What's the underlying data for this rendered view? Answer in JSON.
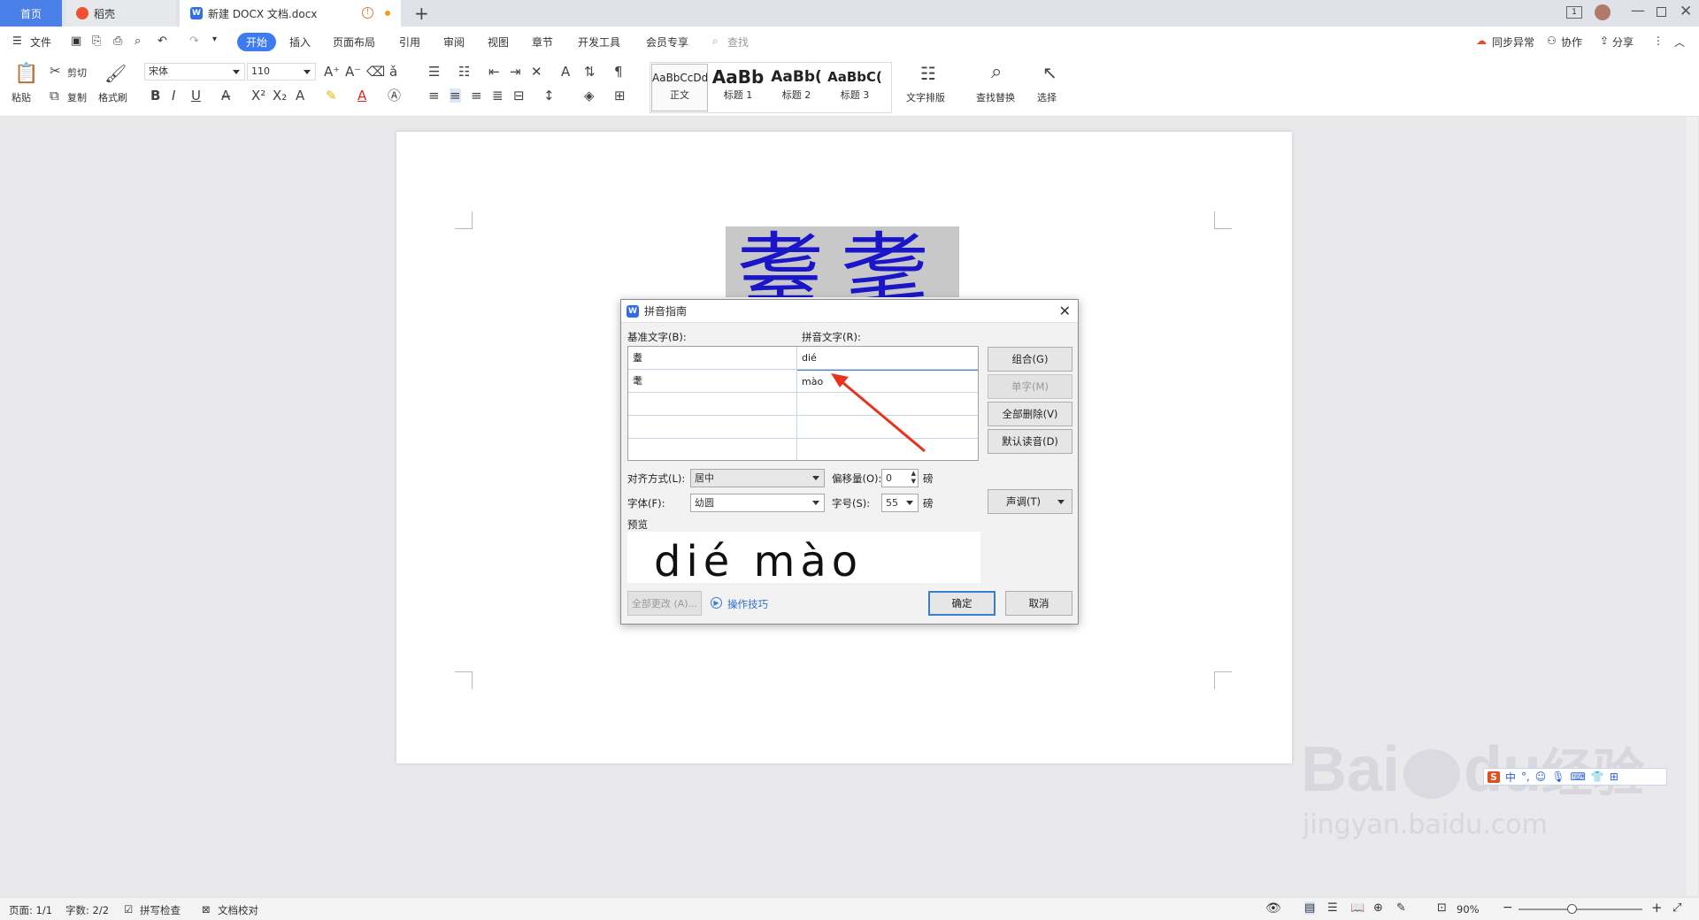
{
  "tabs": {
    "home": "首页",
    "daoke": "稻壳",
    "document": "新建 DOCX 文档.docx"
  },
  "menu": {
    "file": "文件",
    "start": "开始",
    "insert": "插入",
    "layout": "页面布局",
    "reference": "引用",
    "review": "审阅",
    "view": "视图",
    "chapter": "章节",
    "devtools": "开发工具",
    "member": "会员专享",
    "search": "查找",
    "sync": "同步异常",
    "collab": "协作",
    "share": "分享"
  },
  "ribbon": {
    "paste": "粘贴",
    "cut": "剪切",
    "copy": "复制",
    "format_painter": "格式刷",
    "font_name": "宋体",
    "font_size": "110",
    "styles": [
      {
        "sample": "AaBbCcDd",
        "name": "正文"
      },
      {
        "sample": "AaBb",
        "name": "标题 1"
      },
      {
        "sample": "AaBb(",
        "name": "标题 2"
      },
      {
        "sample": "AaBbC(",
        "name": "标题 3"
      }
    ],
    "text_layout": "文字排版",
    "find_replace": "查找替换",
    "select": "选择"
  },
  "document": {
    "base_chars": "耋耄"
  },
  "dialog": {
    "title": "拼音指南",
    "base_text_label": "基准文字(B):",
    "pinyin_text_label": "拼音文字(R):",
    "rows": [
      {
        "base": "耋",
        "pinyin": "dié"
      },
      {
        "base": "耄",
        "pinyin": "mào"
      },
      {
        "base": "",
        "pinyin": ""
      },
      {
        "base": "",
        "pinyin": ""
      },
      {
        "base": "",
        "pinyin": ""
      }
    ],
    "btn_group": "组合(G)",
    "btn_single": "单字(M)",
    "btn_delete_all": "全部删除(V)",
    "btn_default_reading": "默认读音(D)",
    "align_label": "对齐方式(L):",
    "align_value": "居中",
    "offset_label": "偏移量(O):",
    "offset_value": "0",
    "offset_unit": "磅",
    "font_label": "字体(F):",
    "font_value": "幼圆",
    "size_label": "字号(S):",
    "size_value": "55",
    "size_unit": "磅",
    "tone_btn": "声调(T)",
    "preview_label": "预览",
    "preview_text": "dié mào",
    "btn_change_all": "全部更改 (A)...",
    "tips_link": "操作技巧",
    "btn_ok": "确定",
    "btn_cancel": "取消"
  },
  "status": {
    "page": "页面: 1/1",
    "words": "字数: 2/2",
    "spell": "拼写检查",
    "proof": "文档校对",
    "zoom": "90%"
  },
  "ime": {
    "mode": "中"
  },
  "watermark": {
    "brand": "Bai",
    "brand2": "du",
    "cn": "经验",
    "url": "jingyan.baidu.com"
  },
  "colors": {
    "accent": "#3d7cf0",
    "doc_text": "#1a15c8",
    "arrow": "#e8321e"
  }
}
